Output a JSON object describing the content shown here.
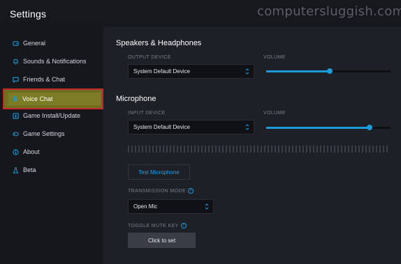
{
  "window": {
    "title": "Settings",
    "watermark": "computersluggish.com"
  },
  "sidebar": {
    "items": [
      {
        "label": "General",
        "icon": "gamepad-icon"
      },
      {
        "label": "Sounds & Notifications",
        "icon": "bell-icon"
      },
      {
        "label": "Friends & Chat",
        "icon": "chat-icon"
      },
      {
        "label": "Voice Chat",
        "icon": "microphone-icon",
        "active": true
      },
      {
        "label": "Game Install/Update",
        "icon": "download-icon"
      },
      {
        "label": "Game Settings",
        "icon": "controller-icon"
      },
      {
        "label": "About",
        "icon": "info-icon"
      },
      {
        "label": "Beta",
        "icon": "flask-icon"
      }
    ]
  },
  "speakers": {
    "heading": "Speakers & Headphones",
    "device_label": "OUTPUT DEVICE",
    "device_value": "System Default Device",
    "volume_label": "VOLUME",
    "volume_fraction": 0.51
  },
  "microphone": {
    "heading": "Microphone",
    "device_label": "INPUT DEVICE",
    "device_value": "System Default Device",
    "volume_label": "VOLUME",
    "volume_fraction": 0.83,
    "test_button": "Test Microphone",
    "transmission_label": "TRANSMISSION MODE",
    "transmission_value": "Open Mic",
    "toggle_label": "TOGGLE MUTE KEY",
    "toggle_button": "Click to set"
  },
  "colors": {
    "accent": "#1b9bd8",
    "highlight": "#6e6f20",
    "highlight_border": "#c7262b"
  }
}
